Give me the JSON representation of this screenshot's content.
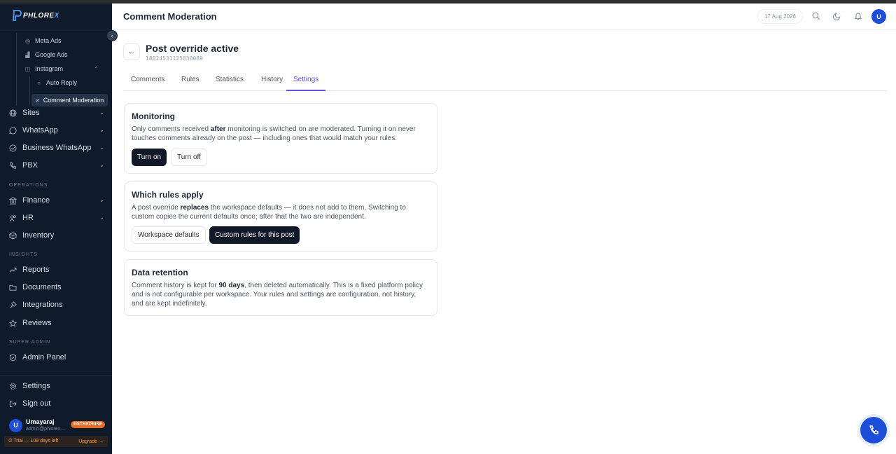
{
  "brand": {
    "name_main": "PHLORE",
    "name_accent": "X"
  },
  "sidebar": {
    "sub_items": [
      {
        "label": "Meta Ads",
        "icon": "meta-icon"
      },
      {
        "label": "Google Ads",
        "icon": "chart-icon"
      },
      {
        "label": "Instagram",
        "icon": "instagram-icon"
      },
      {
        "label": "Auto Reply",
        "icon": "chat-icon"
      }
    ],
    "active_item": {
      "label": "Comment Moderation",
      "icon": "shield-icon"
    },
    "nav": [
      {
        "label": "Sites",
        "icon": "globe-icon"
      },
      {
        "label": "WhatsApp",
        "icon": "whatsapp-icon"
      },
      {
        "label": "Business WhatsApp",
        "icon": "check-circle-icon"
      },
      {
        "label": "PBX",
        "icon": "phone-icon"
      }
    ],
    "sections": {
      "operations": "OPERATIONS",
      "insights": "INSIGHTS",
      "super_admin": "SUPER ADMIN"
    },
    "operations": [
      {
        "label": "Finance",
        "icon": "bank-icon"
      },
      {
        "label": "HR",
        "icon": "people-icon"
      },
      {
        "label": "Inventory",
        "icon": "box-icon"
      }
    ],
    "insights": [
      {
        "label": "Reports",
        "icon": "trend-icon"
      },
      {
        "label": "Documents",
        "icon": "folder-icon"
      },
      {
        "label": "Integrations",
        "icon": "plug-icon"
      },
      {
        "label": "Reviews",
        "icon": "star-icon"
      }
    ],
    "admin": [
      {
        "label": "Admin Panel",
        "icon": "shield-icon"
      }
    ],
    "footer": [
      {
        "label": "Settings",
        "icon": "gear-icon"
      },
      {
        "label": "Sign out",
        "icon": "logout-icon"
      }
    ],
    "user": {
      "initial": "U",
      "name": "Umayaraj",
      "email": "admin@phlorex....",
      "plan": "ENTERPRISE"
    },
    "trial": {
      "text": "⏱ Trial — 109 days left",
      "upgrade": "Upgrade →"
    }
  },
  "topbar": {
    "title": "Comment Moderation",
    "date": "17 Aug 2026",
    "avatar_initial": "U"
  },
  "post": {
    "title": "Post override active",
    "id": "18024531125830089"
  },
  "tabs": [
    "Comments",
    "Rules",
    "Statistics",
    "History",
    "Settings"
  ],
  "active_tab": "Settings",
  "cards": {
    "monitoring": {
      "title": "Monitoring",
      "text_before": "Only comments received ",
      "text_bold": "after",
      "text_after": " monitoring is switched on are moderated. Turning it on never touches comments already on the post — including ones that would match your rules.",
      "btn_on": "Turn on",
      "btn_off": "Turn off"
    },
    "rules": {
      "title": "Which rules apply",
      "text_before": "A post override ",
      "text_bold": "replaces",
      "text_after": " the workspace defaults — it does not add to them. Switching to custom copies the current defaults once; after that the two are independent.",
      "btn_defaults": "Workspace defaults",
      "btn_custom": "Custom rules for this post"
    },
    "retention": {
      "title": "Data retention",
      "text_before": "Comment history is kept for ",
      "text_bold": "90 days",
      "text_after": ", then deleted automatically. This is a fixed platform policy and is not configurable per workspace. Your rules and settings are configuration, not history, and are kept indefinitely."
    }
  },
  "colors": {
    "sidebar_bg": "#0f1a2b",
    "accent": "#6d4bd8",
    "primary_blue": "#1d4ed8",
    "plan_badge": "#ea6a1f"
  }
}
